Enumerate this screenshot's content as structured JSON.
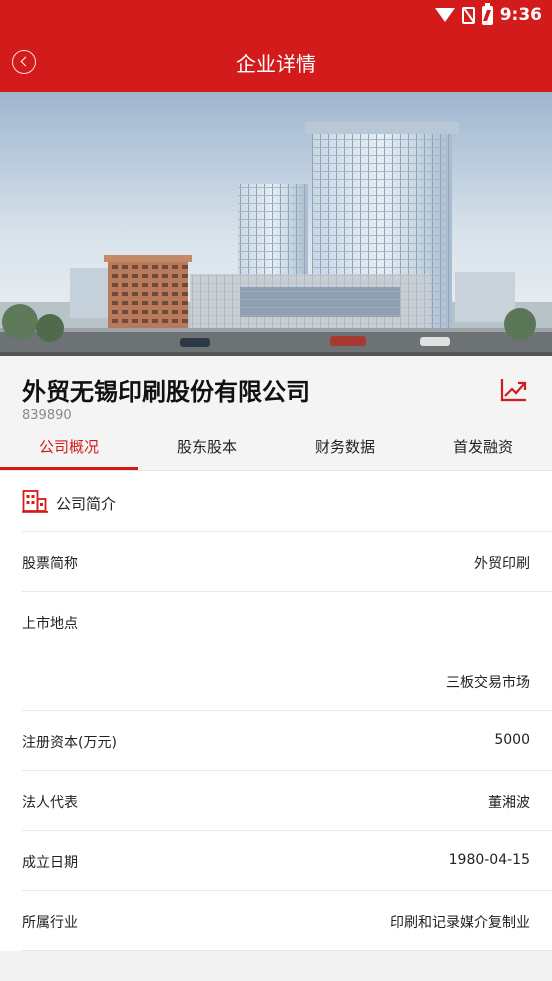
{
  "status_bar": {
    "time": "9:36"
  },
  "header": {
    "title": "企业详情"
  },
  "company": {
    "name": "外贸无锡印刷股份有限公司",
    "code": "839890"
  },
  "tabs": [
    {
      "label": "公司概况",
      "active": true
    },
    {
      "label": "股东股本",
      "active": false
    },
    {
      "label": "财务数据",
      "active": false
    },
    {
      "label": "首发融资",
      "active": false
    }
  ],
  "section": {
    "title": "公司简介"
  },
  "rows": [
    {
      "label": "股票简称",
      "value": "外贸印刷"
    },
    {
      "label": "上市地点",
      "value": "三板交易市场"
    },
    {
      "label": "注册资本(万元)",
      "value": "5000"
    },
    {
      "label": "法人代表",
      "value": "董湘波"
    },
    {
      "label": "成立日期",
      "value": "1980-04-15"
    },
    {
      "label": "所属行业",
      "value": "印刷和记录媒介复制业"
    }
  ],
  "colors": {
    "accent": "#d41b1b",
    "background": "#f2f2f2"
  }
}
